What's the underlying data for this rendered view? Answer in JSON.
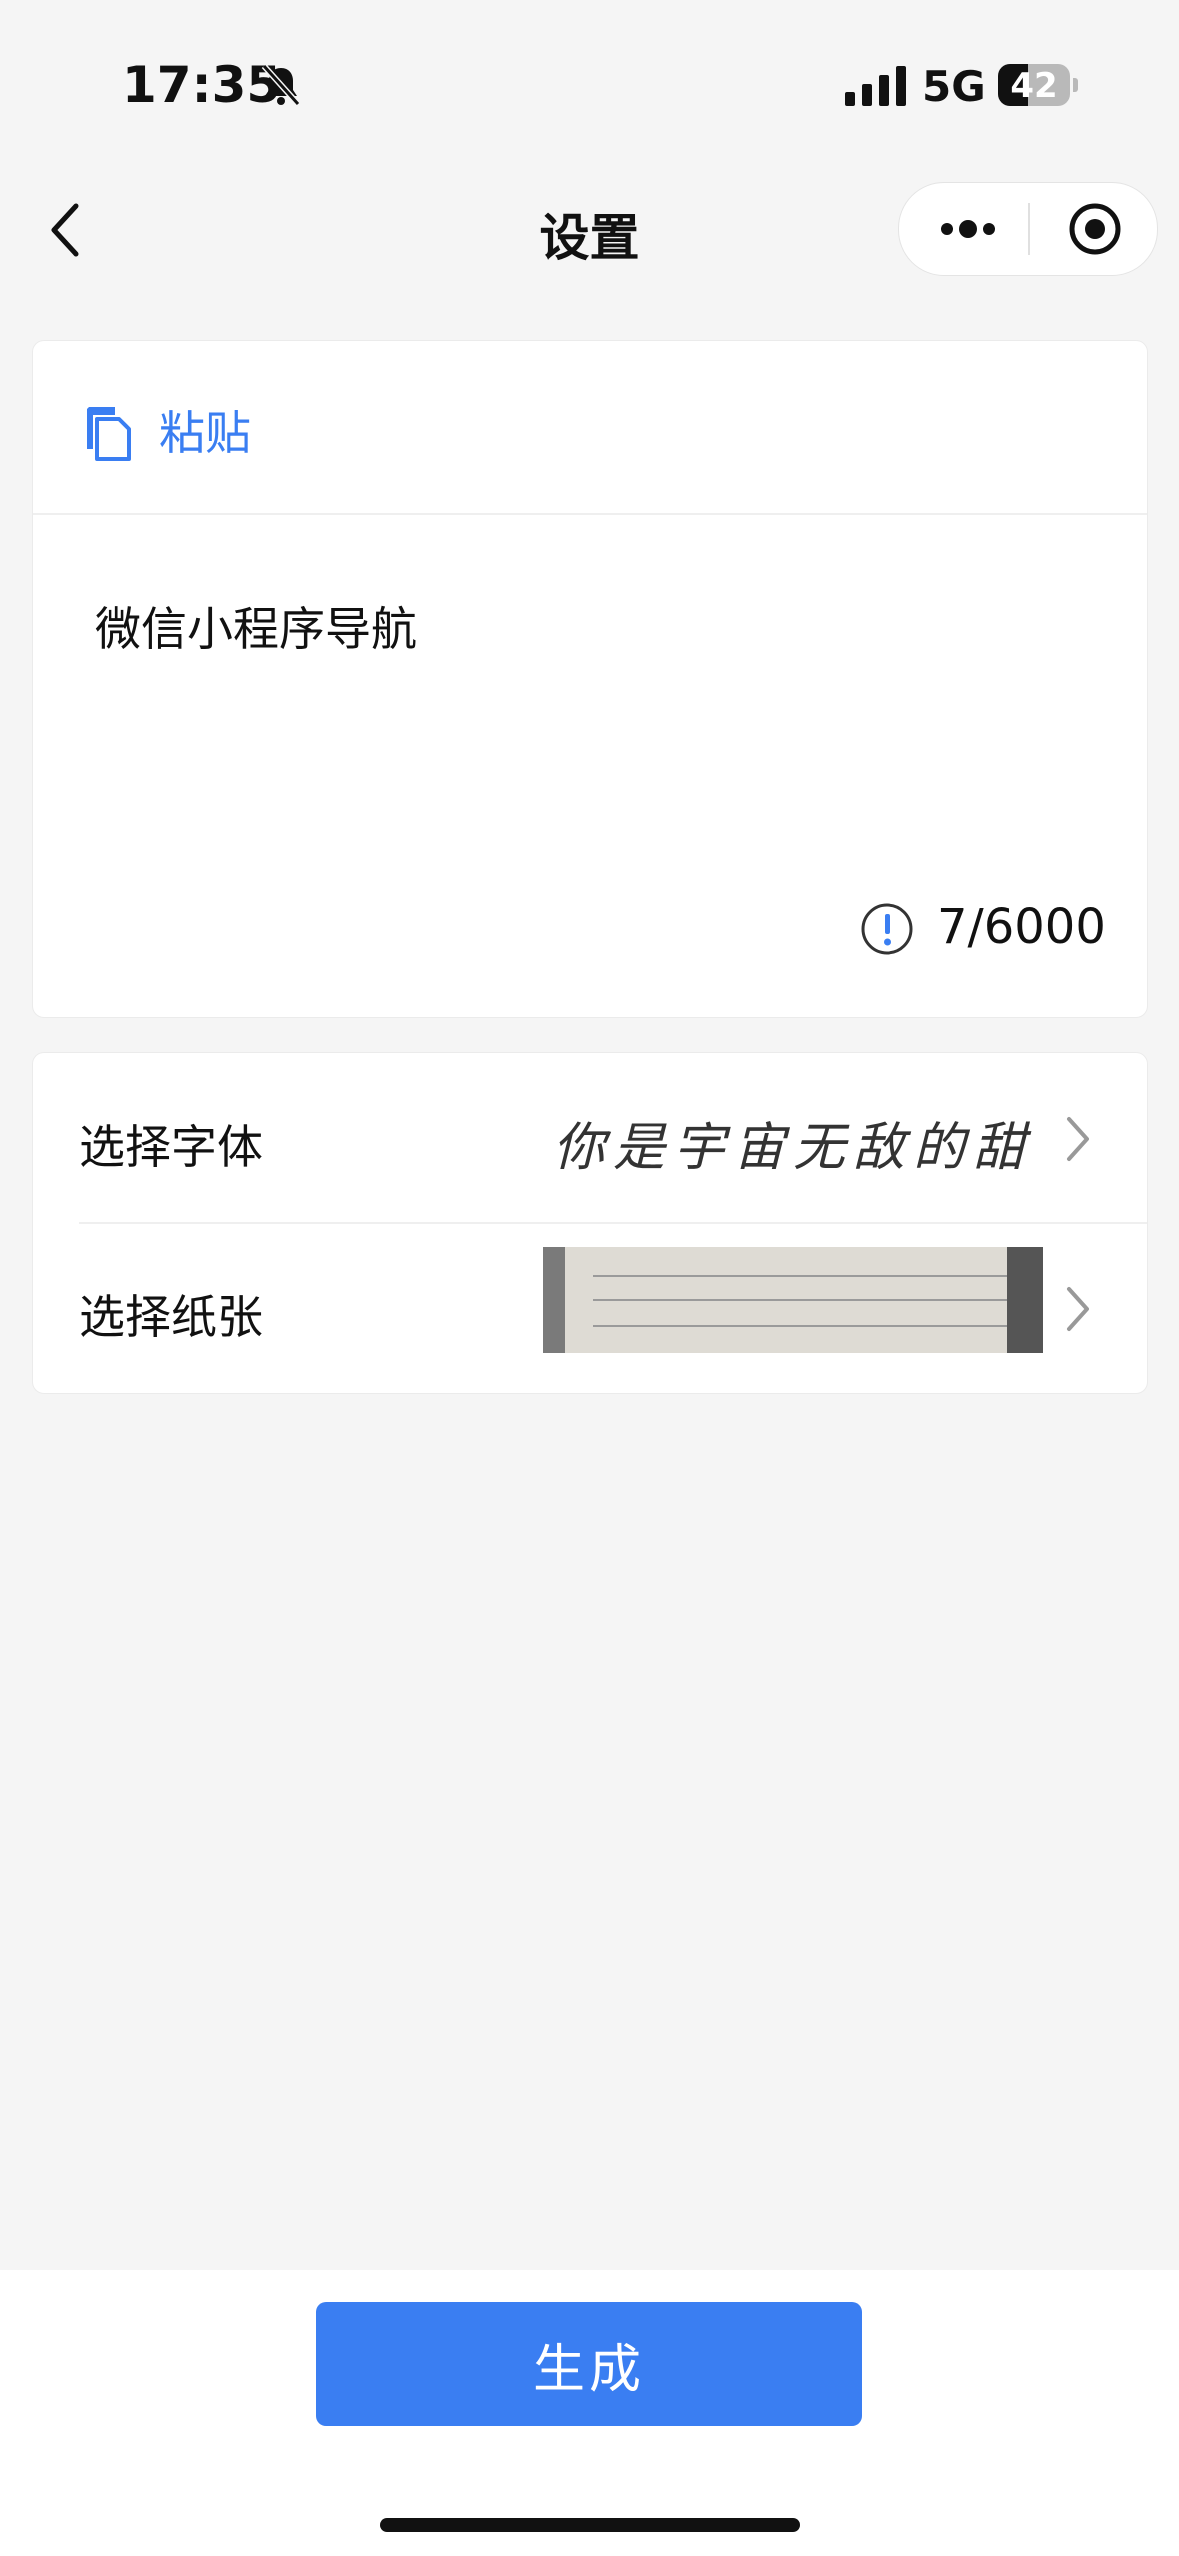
{
  "status_bar": {
    "time": "17:35",
    "network": "5G",
    "battery": "42"
  },
  "nav": {
    "title": "设置"
  },
  "paste": {
    "label": "粘贴"
  },
  "content": {
    "text": "微信小程序导航",
    "count": "7/6000"
  },
  "settings": [
    {
      "label": "选择字体",
      "preview_text": "你是宇宙无敌的甜"
    },
    {
      "label": "选择纸张"
    }
  ],
  "actions": {
    "generate_label": "生成"
  },
  "colors": {
    "accent": "#3a7ef2",
    "background": "#f5f5f5"
  }
}
